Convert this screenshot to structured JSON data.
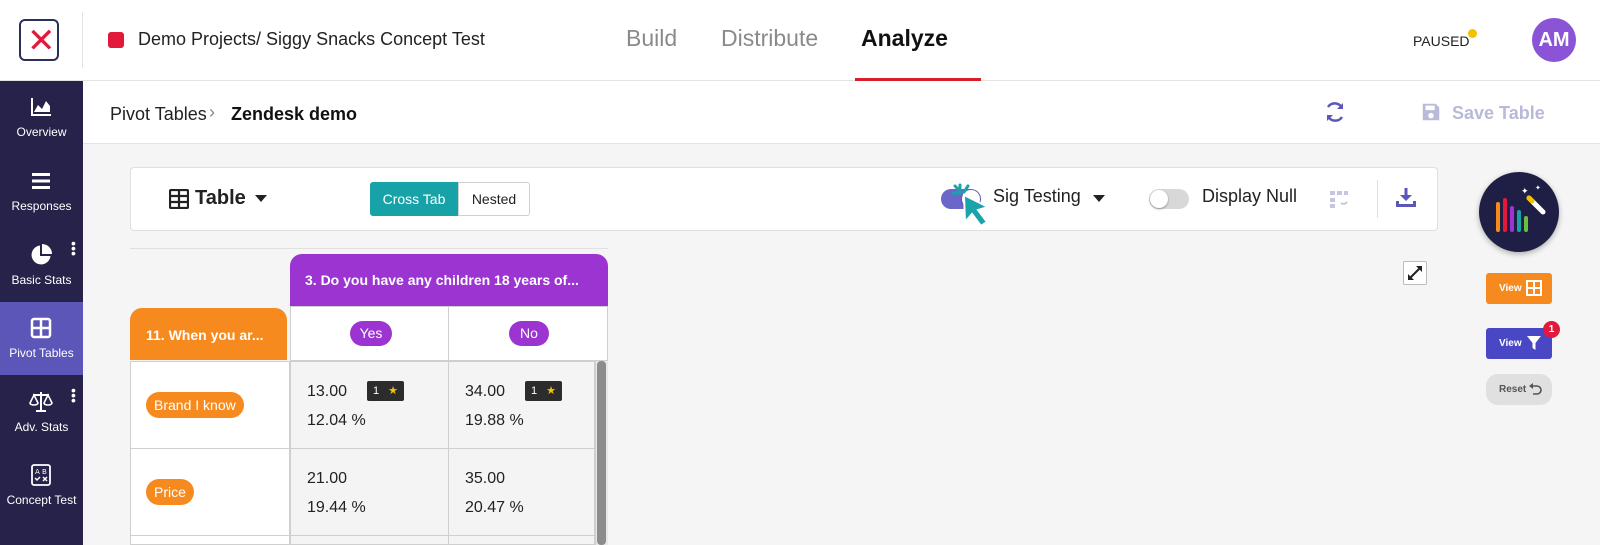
{
  "app": {
    "project_title": "Demo Projects/ Siggy Snacks Concept Test",
    "status": "PAUSED",
    "avatar_initials": "AM",
    "accent": "#5b56b8",
    "brand_red": "#e3193b"
  },
  "nav": {
    "tabs": [
      {
        "label": "Build"
      },
      {
        "label": "Distribute"
      },
      {
        "label": "Analyze",
        "active": true
      }
    ]
  },
  "sidebar": {
    "items": [
      {
        "label": "Overview",
        "icon": "chart-area-icon"
      },
      {
        "label": "Responses",
        "icon": "list-icon"
      },
      {
        "label": "Basic Stats",
        "icon": "pie-chart-icon"
      },
      {
        "label": "Pivot Tables",
        "icon": "table-grid-icon",
        "active": true
      },
      {
        "label": "Adv. Stats",
        "icon": "scale-icon"
      },
      {
        "label": "Concept Test",
        "icon": "ab-test-icon"
      }
    ]
  },
  "breadcrumb": {
    "parent": "Pivot Tables",
    "separator": "›",
    "current": "Zendesk demo"
  },
  "actions": {
    "save_label": "Save Table"
  },
  "toolbar": {
    "view_label": "Table",
    "segments": {
      "cross_tab": "Cross Tab",
      "nested": "Nested",
      "selected": "Cross Tab"
    },
    "sig_testing": {
      "label": "Sig Testing",
      "enabled": true
    },
    "display_null": {
      "label": "Display Null",
      "enabled": false
    }
  },
  "side_panel": {
    "view1_label": "View",
    "view2_label": "View",
    "filter_count": "1",
    "reset_label": "Reset"
  },
  "pivot": {
    "column_question": "3. Do you have any children 18 years of...",
    "row_question": "11. When you ar...",
    "columns": [
      "Yes",
      "No"
    ],
    "rows": [
      {
        "label": "Brand I know",
        "cells": [
          {
            "value": "13.00",
            "pct": "12.04 %",
            "sig": "1"
          },
          {
            "value": "34.00",
            "pct": "19.88 %",
            "sig": "1"
          }
        ]
      },
      {
        "label": "Price",
        "cells": [
          {
            "value": "21.00",
            "pct": "19.44 %"
          },
          {
            "value": "35.00",
            "pct": "20.47 %"
          }
        ]
      }
    ],
    "sig_star": "★"
  }
}
